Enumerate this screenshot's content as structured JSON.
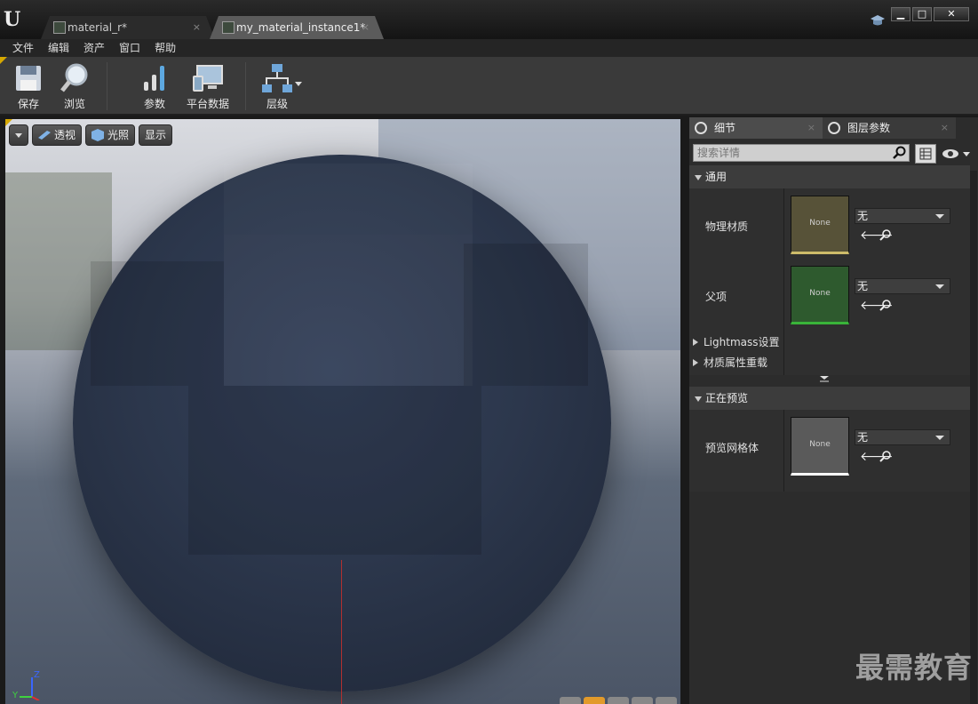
{
  "tabs": [
    {
      "label": "material_r*",
      "close": "×"
    },
    {
      "label": "my_material_instance1*",
      "close": "×"
    }
  ],
  "window": {
    "minimize": "▁",
    "maximize": "□",
    "close": "✕"
  },
  "menu": [
    "文件",
    "编辑",
    "资产",
    "窗口",
    "帮助"
  ],
  "toolbar": {
    "save": "保存",
    "browse": "浏览",
    "params": "参数",
    "platform": "平台数据",
    "hierarchy": "层级"
  },
  "viewport": {
    "perspective": "透视",
    "lit": "光照",
    "show": "显示",
    "axis_z": "Z",
    "axis_y": "Y"
  },
  "details": {
    "tab_details": "细节",
    "tab_layer_params": "图层参数",
    "search_placeholder": "搜索详情",
    "cat_general": "通用",
    "physical_material": "物理材质",
    "parent": "父项",
    "lightmass": "Lightmass设置",
    "material_overrides": "材质属性重载",
    "cat_previewing": "正在预览",
    "preview_mesh": "预览网格体",
    "none_thumb": "None",
    "none_value": "无"
  },
  "watermark": "最需教育",
  "colors": {
    "physical_material_accent": "#cdbb6a",
    "parent_accent": "#39b439",
    "preview_mesh_accent": "#ffffff",
    "toolbar_corner": "#d6a800"
  }
}
